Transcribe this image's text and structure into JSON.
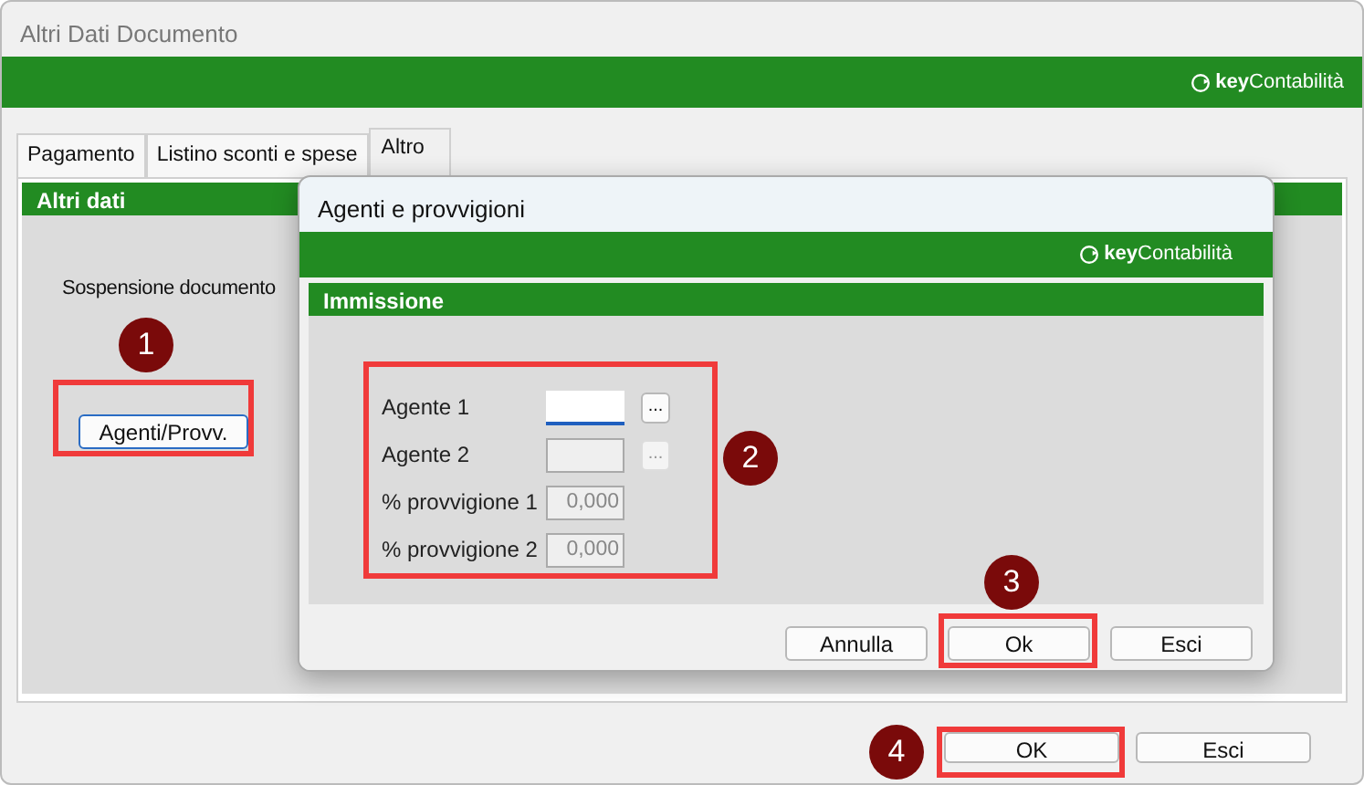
{
  "window": {
    "title": "Altri Dati Documento",
    "brand": "**key**Contabilità"
  },
  "tabs": [
    {
      "label": "Pagamento",
      "selected": false
    },
    {
      "label": "Listino sconti e spese",
      "selected": false
    },
    {
      "label": "Altro",
      "selected": true
    }
  ],
  "panel": {
    "title": "Altri dati",
    "label": "Sospensione documento",
    "button": "Agenti/Provv."
  },
  "dialog": {
    "title": "Agenti e provvigioni",
    "brand": "**key**Contabilità",
    "section": "Immissione",
    "fields": [
      {
        "label": "Agente 1",
        "kind": "lookup",
        "disabled": false,
        "focused": true
      },
      {
        "label": "Agente 2",
        "kind": "lookup",
        "disabled": true,
        "focused": false
      },
      {
        "label": "% provvigione 1",
        "kind": "number",
        "value": "0,000",
        "disabled": true,
        "focused": false
      },
      {
        "label": "% provvigione 2",
        "kind": "number",
        "value": "0,000",
        "disabled": true,
        "focused": false
      }
    ],
    "lookup_button": "...",
    "buttons": [
      "Annulla",
      "Ok",
      "Esci"
    ]
  },
  "footer_buttons": [
    "OK",
    "Esci"
  ],
  "callouts": [
    "1",
    "2",
    "3",
    "4"
  ]
}
